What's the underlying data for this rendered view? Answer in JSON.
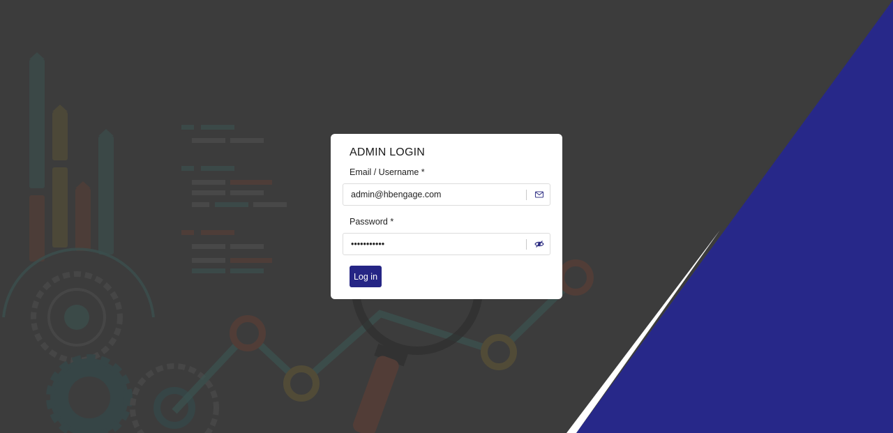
{
  "login": {
    "title": "ADMIN LOGIN",
    "email_label": "Email / Username *",
    "email_value": "admin@hbengage.com",
    "password_label": "Password *",
    "password_masked": "•••••••••••",
    "submit_label": "Log in"
  },
  "icons": {
    "email": "mail-icon",
    "password_toggle": "eye-icon"
  },
  "colors": {
    "background": "#3c3c3c",
    "accent": "#272889",
    "button": "#252585",
    "card": "#ffffff"
  }
}
